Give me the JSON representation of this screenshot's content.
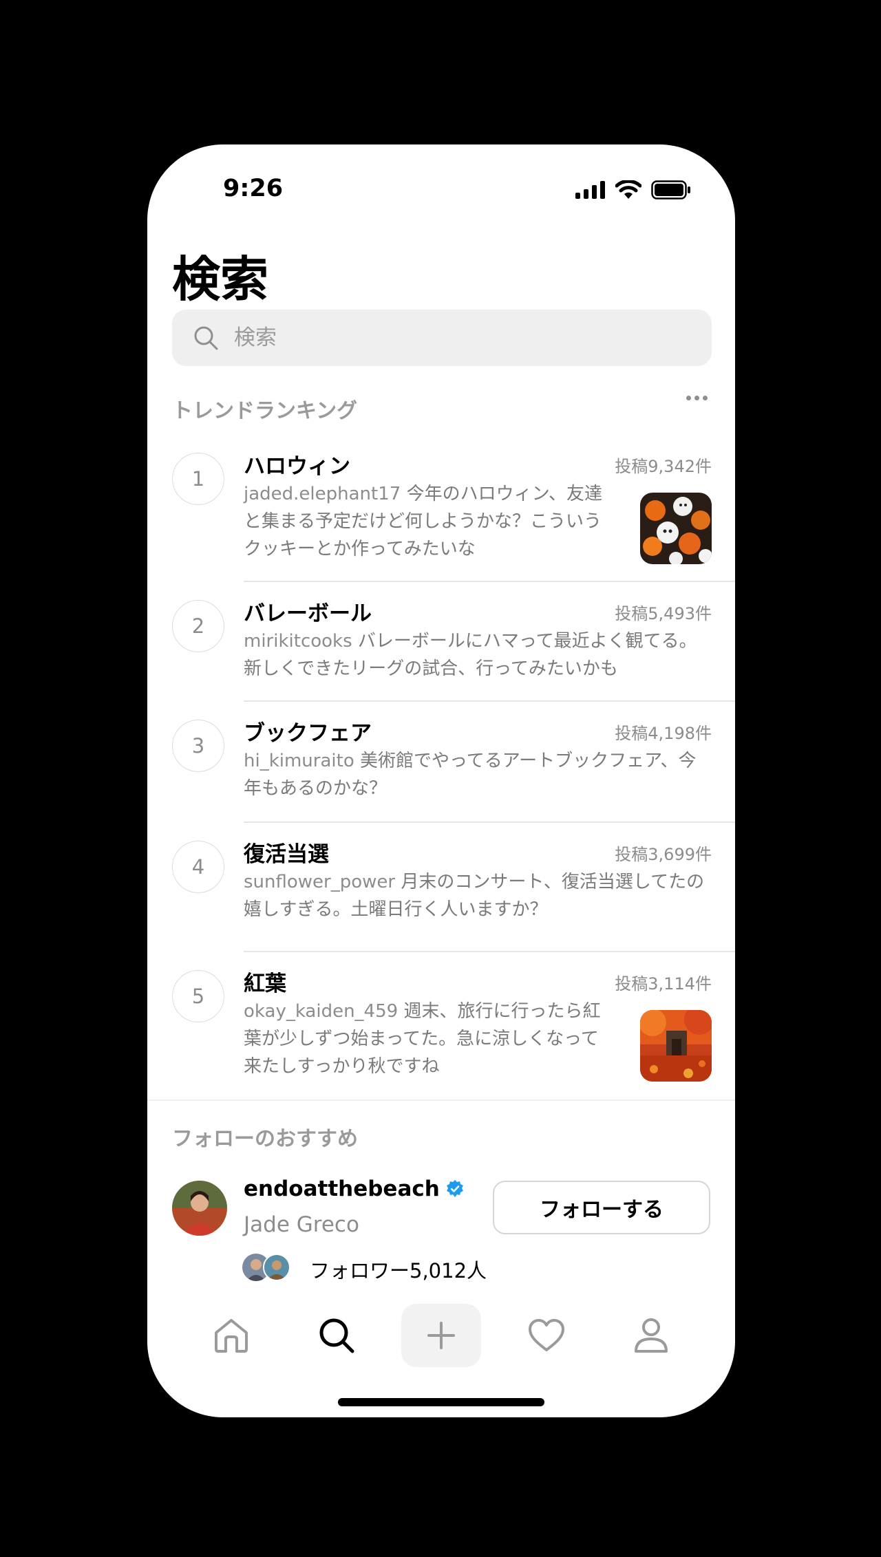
{
  "status_bar": {
    "time": "9:26"
  },
  "page_title": "検索",
  "search": {
    "placeholder": "検索"
  },
  "trending": {
    "label": "トレンドランキング",
    "items": [
      {
        "rank": "1",
        "title": "ハロウィン",
        "count": "投稿9,342件",
        "handle": "jaded.elephant17",
        "text": " 今年のハロウィン、友達と集まる予定だけど何しようかな？こういうクッキーとか作ってみたいな",
        "thumbnail": "halloween-cookies-image"
      },
      {
        "rank": "2",
        "title": "バレーボール",
        "count": "投稿5,493件",
        "handle": "mirikitcooks",
        "text": " バレーボールにハマって最近よく観てる。新しくできたリーグの試合、行ってみたいかも"
      },
      {
        "rank": "3",
        "title": "ブックフェア",
        "count": "投稿4,198件",
        "handle": "hi_kimuraito",
        "text": " 美術館でやってるアートブックフェア、今年もあるのかな？"
      },
      {
        "rank": "4",
        "title": "復活当選",
        "count": "投稿3,699件",
        "handle": "sunflower_power",
        "text": " 月末のコンサート、復活当選してたの嬉しすぎる。土曜日行く人いますか？"
      },
      {
        "rank": "5",
        "title": "紅葉",
        "count": "投稿3,114件",
        "handle": "okay_kaiden_459",
        "text": " 週末、旅行に行ったら紅葉が少しずつ始まってた。急に涼しくなって来たしすっかり秋ですね",
        "thumbnail": "autumn-leaves-image"
      }
    ]
  },
  "suggestions": {
    "label": "フォローのおすすめ",
    "user": {
      "handle": "endoatthebeach",
      "name": "Jade Greco",
      "follow_label": "フォローする",
      "followers_text": "フォロワー5,012人"
    }
  },
  "colors": {
    "accent_verified": "#1d9bf0",
    "secondary_text": "#8c8c8c"
  }
}
